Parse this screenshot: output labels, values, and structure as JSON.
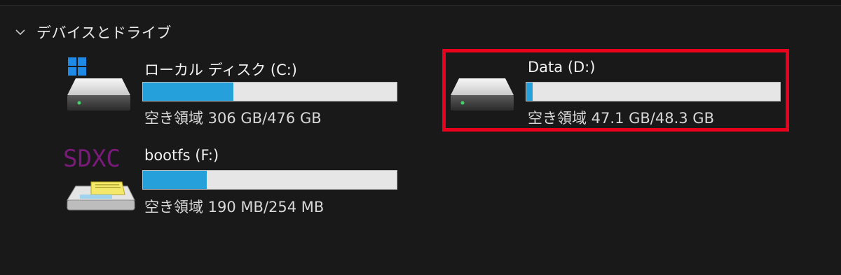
{
  "section": {
    "title": "デバイスとドライブ",
    "chevron_icon": "chevron-down-icon"
  },
  "drives": [
    {
      "name": "ローカル ディスク (C:)",
      "space_text": "空き領域 306 GB/476 GB",
      "used_fraction": 0.357,
      "icon": "windows-system-drive-icon"
    },
    {
      "name": "Data (D:)",
      "space_text": "空き領域 47.1 GB/48.3 GB",
      "used_fraction": 0.025,
      "icon": "hard-drive-icon"
    },
    {
      "name": "bootfs (F:)",
      "space_text": "空き領域 190 MB/254 MB",
      "used_fraction": 0.252,
      "icon": "sdxc-card-icon",
      "icon_text": "SDXC"
    }
  ],
  "colors": {
    "background": "#191919",
    "bar_fill": "#26a0da",
    "bar_track": "#e6e6e6",
    "highlight": "#e8001c",
    "sdxc_text": "#7a1a7a"
  }
}
